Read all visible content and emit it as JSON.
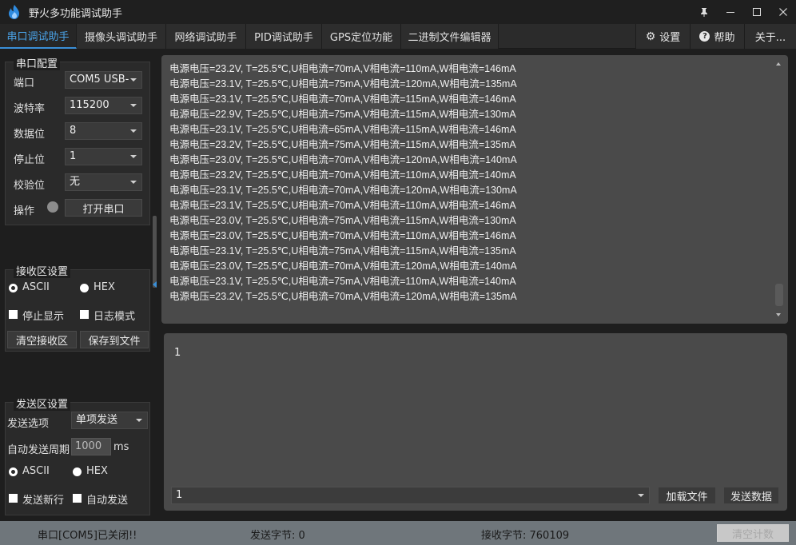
{
  "window": {
    "title": "野火多功能调试助手",
    "controls": [
      "pin-icon",
      "minimize-icon",
      "maximize-icon",
      "close-icon"
    ]
  },
  "tabs": [
    {
      "label": "串口调试助手",
      "active": true
    },
    {
      "label": "摄像头调试助手",
      "active": false
    },
    {
      "label": "网络调试助手",
      "active": false
    },
    {
      "label": "PID调试助手",
      "active": false
    },
    {
      "label": "GPS定位功能",
      "active": false
    },
    {
      "label": "二进制文件编辑器",
      "active": false
    }
  ],
  "tabs_right": [
    {
      "label": "设置",
      "icon": "gear-icon"
    },
    {
      "label": "帮助",
      "icon": "help-icon"
    },
    {
      "label": "关于..."
    }
  ],
  "serial_config": {
    "title": "串口配置",
    "port_label": "端口",
    "port_value": "COM5 USB-",
    "baud_label": "波特率",
    "baud_value": "115200",
    "databits_label": "数据位",
    "databits_value": "8",
    "stopbits_label": "停止位",
    "stopbits_value": "1",
    "parity_label": "校验位",
    "parity_value": "无",
    "operation_label": "操作",
    "open_button": "打开串口"
  },
  "recv_settings": {
    "title": "接收区设置",
    "ascii_label": "ASCII",
    "hex_label": "HEX",
    "mode": "ASCII",
    "stop_display_label": "停止显示",
    "log_mode_label": "日志模式",
    "clear_button": "清空接收区",
    "save_button": "保存到文件"
  },
  "send_settings": {
    "title": "发送区设置",
    "option_label": "发送选项",
    "option_value": "单项发送",
    "period_label": "自动发送周期",
    "period_value": "1000",
    "period_unit": "ms",
    "ascii_label": "ASCII",
    "hex_label": "HEX",
    "mode": "ASCII",
    "newline_label": "发送新行",
    "auto_send_label": "自动发送"
  },
  "receive_lines": [
    "电源电压=23.2V, T=25.5℃,U相电流=70mA,V相电流=110mA,W相电流=146mA",
    "电源电压=23.1V, T=25.5℃,U相电流=75mA,V相电流=120mA,W相电流=135mA",
    "电源电压=23.1V, T=25.5℃,U相电流=70mA,V相电流=115mA,W相电流=146mA",
    "电源电压=22.9V, T=25.5℃,U相电流=75mA,V相电流=115mA,W相电流=130mA",
    "电源电压=23.1V, T=25.5℃,U相电流=65mA,V相电流=115mA,W相电流=146mA",
    "电源电压=23.2V, T=25.5℃,U相电流=75mA,V相电流=115mA,W相电流=135mA",
    "电源电压=23.0V, T=25.5℃,U相电流=70mA,V相电流=120mA,W相电流=140mA",
    "电源电压=23.2V, T=25.5℃,U相电流=70mA,V相电流=110mA,W相电流=140mA",
    "电源电压=23.1V, T=25.5℃,U相电流=70mA,V相电流=120mA,W相电流=130mA",
    "电源电压=23.1V, T=25.5℃,U相电流=70mA,V相电流=110mA,W相电流=146mA",
    "电源电压=23.0V, T=25.5℃,U相电流=75mA,V相电流=115mA,W相电流=130mA",
    "电源电压=23.0V, T=25.5℃,U相电流=70mA,V相电流=110mA,W相电流=146mA",
    "电源电压=23.1V, T=25.5℃,U相电流=75mA,V相电流=115mA,W相电流=135mA",
    "电源电压=23.0V, T=25.5℃,U相电流=70mA,V相电流=120mA,W相电流=140mA",
    "电源电压=23.1V, T=25.5℃,U相电流=75mA,V相电流=110mA,W相电流=140mA",
    "电源电压=23.2V, T=25.5℃,U相电流=70mA,V相电流=120mA,W相电流=135mA"
  ],
  "send_area": {
    "text": "1",
    "history_value": "1",
    "load_file_button": "加载文件",
    "send_button": "发送数据"
  },
  "status": {
    "port_state": "串口[COM5]已关闭!!",
    "sent_bytes": "发送字节: 0",
    "recv_bytes": "接收字节: 760109",
    "clear_count_button": "清空计数"
  },
  "colors": {
    "accent": "#3a8fd8",
    "background": "#1e1e1e",
    "textarea": "#4a4a4a",
    "statusbar": "#6f767b"
  }
}
